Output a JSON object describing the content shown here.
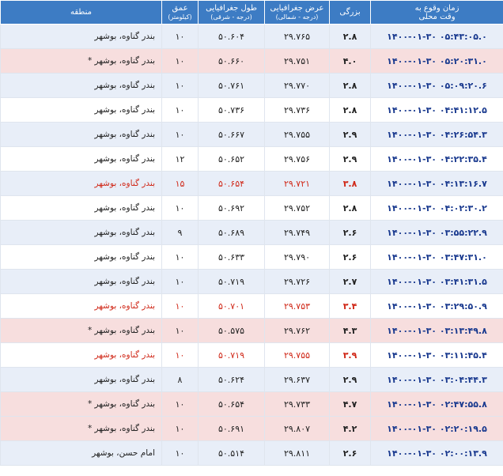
{
  "headers": {
    "time": {
      "title": "زمان وقوع به",
      "sub": "وقت محلی"
    },
    "magnitude": {
      "title": "بزرگی",
      "sub": ""
    },
    "latitude": {
      "title": "عرض جغرافیایی",
      "sub": "(درجه - شمالی)"
    },
    "longitude": {
      "title": "طول جغرافیایی",
      "sub": "(درجه - شرقی)"
    },
    "depth": {
      "title": "عمق",
      "sub": "(کیلومتر)"
    },
    "region": {
      "title": "منطقه",
      "sub": ""
    }
  },
  "colors": {
    "header": "#3d7cc4",
    "row_blue": "#e8eef8",
    "row_pink": "#f7dede",
    "alert_text": "#d02818",
    "time_text": "#1a3a8f"
  },
  "rows": [
    {
      "time": "۱۴۰۰-۰۱-۳۰ ۰۵:۴۳:۰۵.۰",
      "magnitude": "۲.۸",
      "latitude": "۲۹.۷۶۵",
      "longitude": "۵۰.۶۰۴",
      "depth": "۱۰",
      "region": "بندر گناوه، بوشهر",
      "style": "blue"
    },
    {
      "time": "۱۴۰۰-۰۱-۳۰ ۰۵:۲۰:۳۱.۰",
      "magnitude": "۴.۰",
      "latitude": "۲۹.۷۵۱",
      "longitude": "۵۰.۶۶۰",
      "depth": "۱۰",
      "region": "بندر گناوه، بوشهر *",
      "style": "pink"
    },
    {
      "time": "۱۴۰۰-۰۱-۳۰ ۰۵:۰۹:۲۰.۶",
      "magnitude": "۲.۸",
      "latitude": "۲۹.۷۷۰",
      "longitude": "۵۰.۷۶۱",
      "depth": "۱۰",
      "region": "بندر گناوه، بوشهر",
      "style": "blue"
    },
    {
      "time": "۱۴۰۰-۰۱-۳۰ ۰۴:۴۱:۱۲.۵",
      "magnitude": "۲.۸",
      "latitude": "۲۹.۷۳۶",
      "longitude": "۵۰.۷۳۶",
      "depth": "۱۰",
      "region": "بندر گناوه، بوشهر",
      "style": "white"
    },
    {
      "time": "۱۴۰۰-۰۱-۳۰ ۰۴:۲۶:۵۴.۳",
      "magnitude": "۲.۹",
      "latitude": "۲۹.۷۵۵",
      "longitude": "۵۰.۶۶۷",
      "depth": "۱۰",
      "region": "بندر گناوه، بوشهر",
      "style": "blue"
    },
    {
      "time": "۱۴۰۰-۰۱-۳۰ ۰۴:۲۲:۳۵.۴",
      "magnitude": "۲.۹",
      "latitude": "۲۹.۷۵۶",
      "longitude": "۵۰.۶۵۲",
      "depth": "۱۲",
      "region": "بندر گناوه، بوشهر",
      "style": "white"
    },
    {
      "time": "۱۴۰۰-۰۱-۳۰ ۰۴:۱۳:۱۶.۷",
      "magnitude": "۳.۸",
      "latitude": "۲۹.۷۲۱",
      "longitude": "۵۰.۶۵۴",
      "depth": "۱۵",
      "region": "بندر گناوه، بوشهر",
      "style": "blue-red"
    },
    {
      "time": "۱۴۰۰-۰۱-۳۰ ۰۴:۰۲:۳۰.۲",
      "magnitude": "۲.۸",
      "latitude": "۲۹.۷۵۲",
      "longitude": "۵۰.۶۹۲",
      "depth": "۱۰",
      "region": "بندر گناوه، بوشهر",
      "style": "white"
    },
    {
      "time": "۱۴۰۰-۰۱-۳۰ ۰۳:۵۵:۲۲.۹",
      "magnitude": "۲.۶",
      "latitude": "۲۹.۷۴۹",
      "longitude": "۵۰.۶۸۹",
      "depth": "۹",
      "region": "بندر گناوه، بوشهر",
      "style": "blue"
    },
    {
      "time": "۱۴۰۰-۰۱-۳۰ ۰۳:۴۷:۳۱.۰",
      "magnitude": "۲.۶",
      "latitude": "۲۹.۷۹۰",
      "longitude": "۵۰.۶۳۳",
      "depth": "۱۰",
      "region": "بندر گناوه، بوشهر",
      "style": "white"
    },
    {
      "time": "۱۴۰۰-۰۱-۳۰ ۰۳:۴۱:۳۱.۵",
      "magnitude": "۲.۷",
      "latitude": "۲۹.۷۲۶",
      "longitude": "۵۰.۷۱۹",
      "depth": "۱۰",
      "region": "بندر گناوه، بوشهر",
      "style": "blue"
    },
    {
      "time": "۱۴۰۰-۰۱-۳۰ ۰۳:۲۹:۵۰.۹",
      "magnitude": "۳.۴",
      "latitude": "۲۹.۷۵۳",
      "longitude": "۵۰.۷۰۱",
      "depth": "۱۰",
      "region": "بندر گناوه، بوشهر",
      "style": "white-red"
    },
    {
      "time": "۱۴۰۰-۰۱-۳۰ ۰۳:۱۳:۴۹.۸",
      "magnitude": "۴.۳",
      "latitude": "۲۹.۷۶۲",
      "longitude": "۵۰.۵۷۵",
      "depth": "۱۰",
      "region": "بندر گناوه، بوشهر *",
      "style": "pink"
    },
    {
      "time": "۱۴۰۰-۰۱-۳۰ ۰۳:۱۱:۴۵.۴",
      "magnitude": "۳.۹",
      "latitude": "۲۹.۷۵۵",
      "longitude": "۵۰.۷۱۹",
      "depth": "۱۰",
      "region": "بندر گناوه، بوشهر",
      "style": "white-red"
    },
    {
      "time": "۱۴۰۰-۰۱-۳۰ ۰۳:۰۴:۴۴.۳",
      "magnitude": "۲.۹",
      "latitude": "۲۹.۶۳۷",
      "longitude": "۵۰.۶۲۴",
      "depth": "۸",
      "region": "بندر گناوه، بوشهر",
      "style": "blue"
    },
    {
      "time": "۱۴۰۰-۰۱-۳۰ ۰۲:۴۷:۵۵.۸",
      "magnitude": "۴.۷",
      "latitude": "۲۹.۷۳۳",
      "longitude": "۵۰.۶۵۴",
      "depth": "۱۰",
      "region": "بندر گناوه، بوشهر *",
      "style": "pink"
    },
    {
      "time": "۱۴۰۰-۰۱-۳۰ ۰۲:۲۰:۱۹.۵",
      "magnitude": "۴.۲",
      "latitude": "۲۹.۸۰۷",
      "longitude": "۵۰.۶۹۱",
      "depth": "۱۰",
      "region": "بندر گناوه، بوشهر *",
      "style": "pink"
    },
    {
      "time": "۱۴۰۰-۰۱-۳۰ ۰۲:۰۰:۱۳.۹",
      "magnitude": "۲.۶",
      "latitude": "۲۹.۸۱۱",
      "longitude": "۵۰.۵۱۴",
      "depth": "۱۰",
      "region": "امام حسن، بوشهر",
      "style": "blue"
    }
  ]
}
